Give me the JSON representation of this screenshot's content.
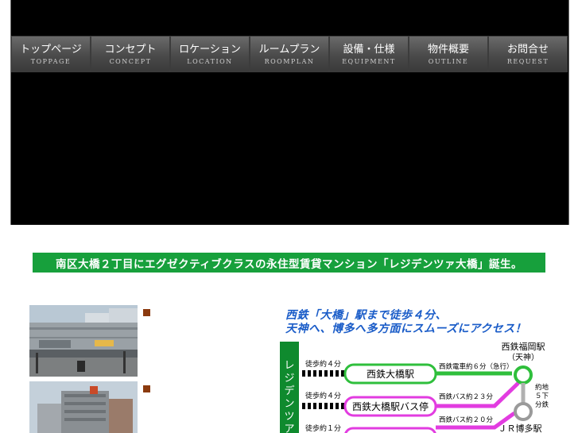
{
  "nav": {
    "items": [
      {
        "jp": "トップページ",
        "en": "TOPPAGE"
      },
      {
        "jp": "コンセプト",
        "en": "CONCEPT"
      },
      {
        "jp": "ロケーション",
        "en": "LOCATION"
      },
      {
        "jp": "ルームプラン",
        "en": "ROOMPLAN"
      },
      {
        "jp": "設備・仕様",
        "en": "EQUIPMENT"
      },
      {
        "jp": "物件概要",
        "en": "OUTLINE"
      },
      {
        "jp": "お問合せ",
        "en": "REQUEST"
      }
    ]
  },
  "banner": {
    "text": "南区大橋２丁目にエグゼクティブクラスの永住型賃貸マンション「レジデンツァ大橋」誕生。"
  },
  "access": {
    "line1": "西鉄「大橋」駅まで徒歩４分、",
    "line2": "天神へ、博多へ多方面にスムーズにアクセス！"
  },
  "map": {
    "origin": "レジデンツア",
    "walk1": "徒歩約４分",
    "walk2": "徒歩約４分",
    "walk3": "徒歩約１分",
    "station1": "西鉄大橋駅",
    "station2": "西鉄大橋駅バス停",
    "route1": "西鉄電車約６分（急行）",
    "route2": "西鉄バス約２３分",
    "route3": "西鉄バス約２０分",
    "dest1_name": "西鉄福岡駅",
    "dest1_sub": "（天神）",
    "subway_note1": "約地",
    "subway_note2": "５下",
    "subway_note3": "分鉄",
    "dest2_name": "ＪＲ博多駅",
    "colors": {
      "green": "#2fbf3c",
      "pink": "#e23ce0",
      "dark_green": "#0f8a2e"
    }
  }
}
